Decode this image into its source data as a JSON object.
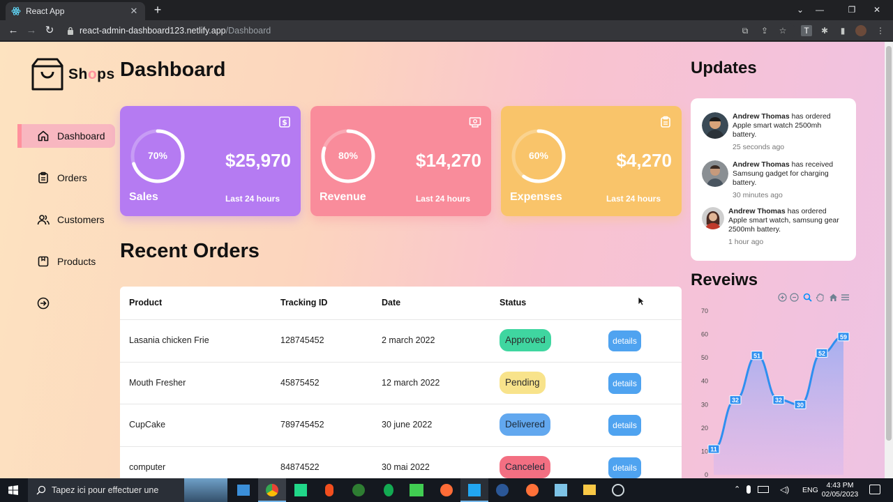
{
  "browser": {
    "tab_title": "React App",
    "url_host": "react-admin-dashboard123.netlify.app",
    "url_path": "/Dashboard"
  },
  "logo": {
    "text_pre": "Sh",
    "text_o": "o",
    "text_post": "ps"
  },
  "sidebar": {
    "items": [
      {
        "label": "Dashboard",
        "icon": "home-icon",
        "active": true
      },
      {
        "label": "Orders",
        "icon": "clipboard-icon",
        "active": false
      },
      {
        "label": "Customers",
        "icon": "users-icon",
        "active": false
      },
      {
        "label": "Products",
        "icon": "package-icon",
        "active": false
      },
      {
        "label": "",
        "icon": "logout-icon",
        "active": false
      }
    ]
  },
  "main": {
    "title": "Dashboard",
    "recent_title": "Recent Orders",
    "cards": [
      {
        "title": "Sales",
        "percent": "70%",
        "percent_value": 70,
        "amount": "$25,970",
        "period": "Last 24 hours",
        "color": "#b57bf2",
        "icon": "dollar-icon"
      },
      {
        "title": "Revenue",
        "percent": "80%",
        "percent_value": 80,
        "amount": "$14,270",
        "period": "Last 24 hours",
        "color": "#f98c9b",
        "icon": "money-icon"
      },
      {
        "title": "Expenses",
        "percent": "60%",
        "percent_value": 60,
        "amount": "$4,270",
        "period": "Last 24 hours",
        "color": "#f9c46a",
        "icon": "clipboard-icon"
      }
    ],
    "table": {
      "headers": [
        "Product",
        "Tracking ID",
        "Date",
        "Status"
      ],
      "rows": [
        {
          "product": "Lasania chicken Frie",
          "tracking": "128745452",
          "date": "2 march 2022",
          "status": "Approved",
          "status_color": "#3fd6a0",
          "action": "details"
        },
        {
          "product": "Mouth Fresher",
          "tracking": "45875452",
          "date": "12 march 2022",
          "status": "Pending",
          "status_color": "#f8e38b",
          "action": "details"
        },
        {
          "product": "CupCake",
          "tracking": "789745452",
          "date": "30 june 2022",
          "status": "Delivered",
          "status_color": "#62a8ef",
          "action": "details"
        },
        {
          "product": "computer",
          "tracking": "84874522",
          "date": "30 mai 2022",
          "status": "Canceled",
          "status_color": "#f36f82",
          "action": "details"
        }
      ]
    }
  },
  "right": {
    "updates_title": "Updates",
    "updates": [
      {
        "name": "Andrew Thomas",
        "action": " has ordered",
        "detail": "Apple smart watch 2500mh battery.",
        "time": "25 seconds ago"
      },
      {
        "name": "Andrew Thomas",
        "action": " has received",
        "detail": "Samsung gadget for charging battery.",
        "time": "30 minutes ago"
      },
      {
        "name": "Andrew Thomas",
        "action": " has ordered",
        "detail": "Apple smart watch, samsung gear 2500mh battery.",
        "time": "1 hour ago"
      }
    ],
    "reviews_title": "Reveiws"
  },
  "chart_data": {
    "type": "area",
    "title": "",
    "x": [
      1,
      2,
      3,
      4,
      5,
      6,
      7
    ],
    "values": [
      11,
      32,
      51,
      32,
      30,
      52,
      59
    ],
    "ylim": [
      0,
      70
    ],
    "yticks": [
      "0",
      "10",
      "20",
      "30",
      "40",
      "50",
      "60",
      "70"
    ],
    "color": "#2e8ff0",
    "grid": false
  },
  "taskbar": {
    "search_placeholder": "Tapez ici pour effectuer une",
    "lang": "ENG",
    "time": "4:43 PM",
    "date": "02/05/2023"
  }
}
